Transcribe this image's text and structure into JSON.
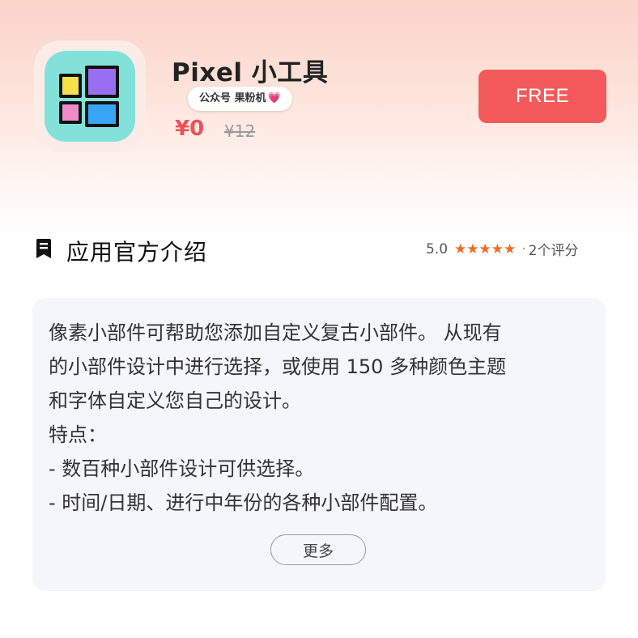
{
  "app": {
    "name": "Pixel 小工具",
    "price": "¥0",
    "original_price": "¥12",
    "get_button_label": "FREE"
  },
  "watermark": {
    "text": "公众号 果粉机",
    "emoji": "💗"
  },
  "section": {
    "title": "应用官方介绍",
    "rating_score": "5.0",
    "stars": "★★★★★",
    "rating_separator": "·",
    "rating_count": "2个评分"
  },
  "description": {
    "lines": [
      "像素小部件可帮助您添加自定义复古小部件。 从现有",
      "的小部件设计中进行选择，或使用 150 多种颜色主题",
      "和字体自定义您自己的设计。",
      "特点：",
      "- 数百种小部件设计可供选择。",
      "- 时间/日期、进行中年份的各种小部件配置。"
    ],
    "more_label": "更多"
  },
  "colors": {
    "accent": "#f45a5b",
    "price": "#ef4f58",
    "star": "#f46b1c",
    "card_bg": "#f4f6fb",
    "icon_bg": "#82e2da"
  },
  "icons": {
    "app_icon": "pixel-widgets-app-icon",
    "section_icon": "bookmark-icon"
  }
}
